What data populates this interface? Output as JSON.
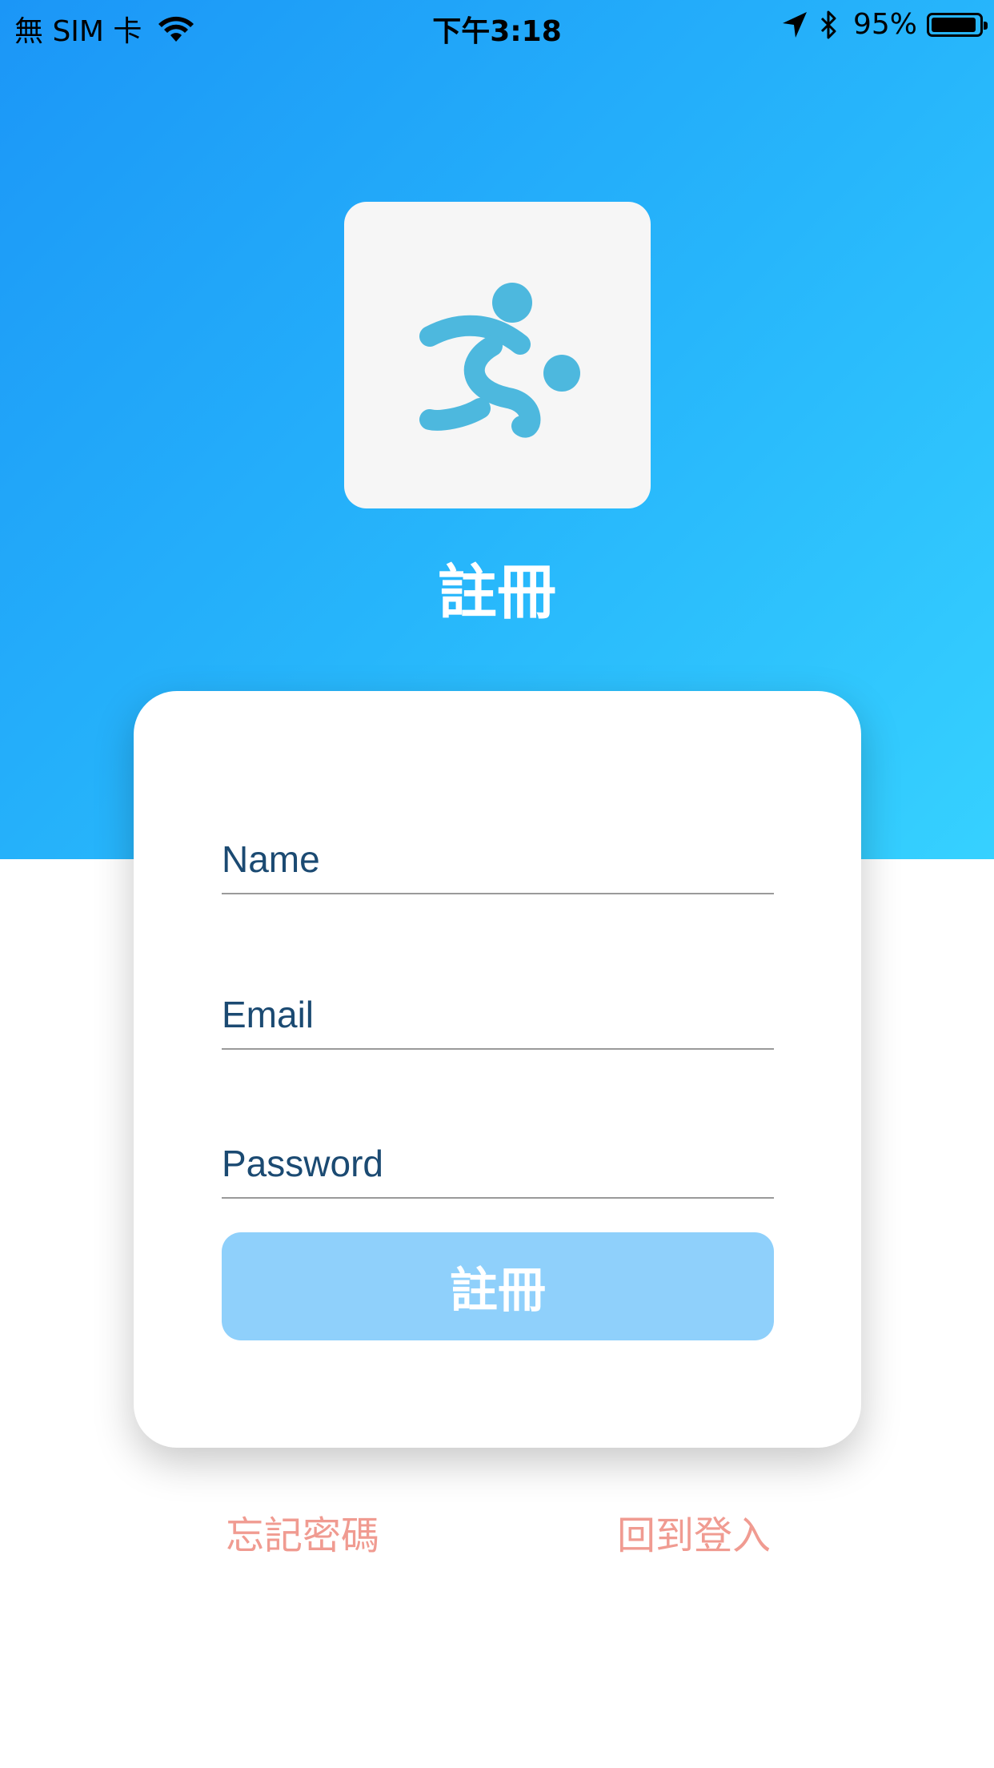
{
  "status_bar": {
    "carrier": "無 SIM 卡",
    "time": "下午3:18",
    "battery_percent_label": "95%",
    "battery_level": 0.95,
    "icons": [
      "wifi-icon",
      "location-arrow-icon",
      "bluetooth-icon",
      "battery-icon"
    ]
  },
  "header": {
    "logo_icon": "runner-kicking-ball-icon",
    "title": "註冊"
  },
  "form": {
    "name_placeholder": "Name",
    "email_placeholder": "Email",
    "password_placeholder": "Password",
    "submit_label": "註冊"
  },
  "links": {
    "forgot_password": "忘記密碼",
    "back_to_login": "回到登入"
  },
  "colors": {
    "gradient_start": "#1b96f7",
    "gradient_end": "#36d1ff",
    "logo_icon": "#4db8de",
    "field_text": "#1b4a72",
    "button_bg": "#8fd0fb",
    "link_text": "#f09b91"
  }
}
